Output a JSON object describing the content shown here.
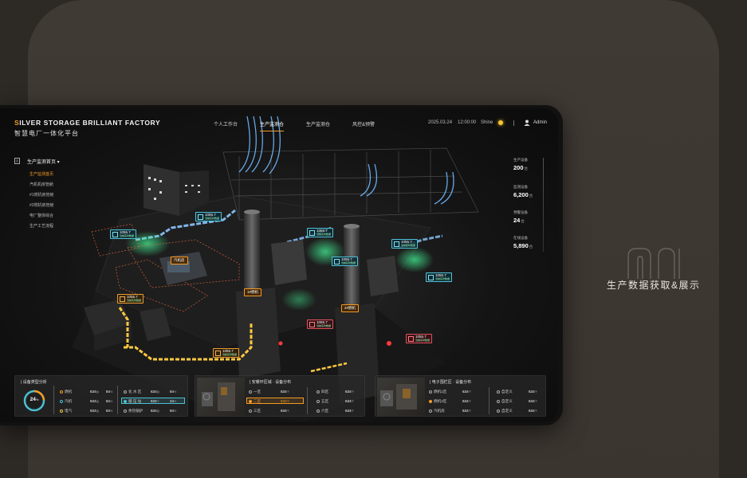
{
  "caption": {
    "text": "生产数据获取&展示"
  },
  "header": {
    "title_first": "S",
    "title_rest": "ILVER STORAGE BRILLIANT FACTORY",
    "subtitle": "智慧电厂一体化平台",
    "nav": [
      "个人工作台",
      "生产监测仓",
      "生产监测仓",
      "风控&预警"
    ],
    "date": "2025.03.24",
    "time": "12:00:00",
    "weather": "Shine",
    "user": "Admin"
  },
  "sidebar": {
    "title": "生产监测首页 ▾",
    "items": [
      "生产监测首页",
      "汽机机房管舱",
      "#1燃机房管舱",
      "#2燃机房管舱",
      "电厂整体综合",
      "生产工艺流程"
    ]
  },
  "stats": [
    {
      "label": "生产设备",
      "value": "200",
      "unit": "台"
    },
    {
      "label": "监测设备",
      "value": "6,200",
      "unit": "台"
    },
    {
      "label": "预警设备",
      "value": "24",
      "unit": "台"
    },
    {
      "label": "在线设备",
      "value": "5,890",
      "unit": "台"
    }
  ],
  "scene": {
    "tags": [
      {
        "value": "1055.7",
        "sub": "当前实时数据"
      },
      {
        "value": "1055.7",
        "sub": "当前实时数据"
      },
      {
        "value": "1055.7",
        "sub": "当前实时数据"
      },
      {
        "value": "1055.7",
        "sub": "当前实时数据"
      },
      {
        "value": "1055.7",
        "sub": "当前实时数据"
      },
      {
        "value": "1055.7",
        "sub": "当前实时数据"
      },
      {
        "value": "1055.7",
        "sub": "当前实时数据"
      },
      {
        "value": "1055.7",
        "sub": "当前实时数据"
      },
      {
        "value": "1055.7",
        "sub": "当前实时数据"
      },
      {
        "value": "1055.7",
        "sub": "当前实时数据"
      }
    ],
    "labels": [
      "汽机房",
      "1#燃机",
      "2#燃机"
    ]
  },
  "panels": {
    "types": {
      "title": "| 设备类型分析",
      "gauge": "24",
      "gauge_unit": "%",
      "gauge_pct": 24,
      "left": [
        {
          "name": "燃机",
          "value": "634",
          "unit": "台",
          "pct": "84",
          "pu": "%"
        },
        {
          "name": "汽机",
          "value": "634",
          "unit": "台",
          "pct": "84",
          "pu": "%"
        },
        {
          "name": "电气",
          "value": "634",
          "unit": "台",
          "pct": "84",
          "pu": "%"
        }
      ],
      "right": [
        {
          "name": "化 水 区",
          "value": "634",
          "unit": "台",
          "pct": "84",
          "pu": "%"
        },
        {
          "name": "循 压 站",
          "value": "634",
          "unit": "个",
          "pct": "24",
          "pu": "%"
        },
        {
          "name": "余热锅炉",
          "value": "634",
          "unit": "台",
          "pct": "84",
          "pu": "%"
        }
      ]
    },
    "steam": {
      "title": "| 安暖环区域 · 设备分布",
      "left": [
        {
          "name": "一区",
          "value": "634",
          "unit": "个"
        },
        {
          "name": "二区",
          "value": "634",
          "unit": "个"
        },
        {
          "name": "三区",
          "value": "634",
          "unit": "个"
        }
      ],
      "right": [
        {
          "name": "四区",
          "value": "634",
          "unit": "个"
        },
        {
          "name": "五区",
          "value": "634",
          "unit": "个"
        },
        {
          "name": "六区",
          "value": "634",
          "unit": "个"
        }
      ]
    },
    "electric": {
      "title": "| 电子围栏区 · 设备分布",
      "left": [
        {
          "name": "燃机1区",
          "value": "634",
          "unit": "个"
        },
        {
          "name": "燃机2区",
          "value": "634",
          "unit": "个"
        },
        {
          "name": "汽机房",
          "value": "634",
          "unit": "个"
        }
      ],
      "right": [
        {
          "name": "自定义",
          "value": "634",
          "unit": "个"
        },
        {
          "name": "自定义",
          "value": "634",
          "unit": "个"
        },
        {
          "name": "自定义",
          "value": "634",
          "unit": "个"
        }
      ]
    }
  },
  "colors": {
    "accent": "#f59a23",
    "cyan": "#49c1d0",
    "background": "#2d2925",
    "card": "#3e3832"
  }
}
